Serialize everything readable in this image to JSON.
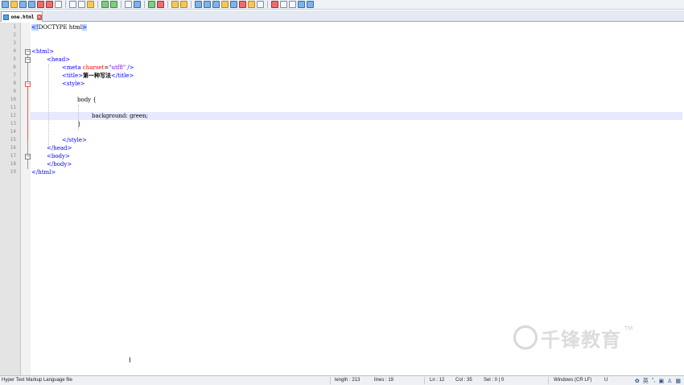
{
  "tab": {
    "label": "one.html"
  },
  "toolbar": {
    "buttons": [
      "new-file-icon",
      "open-file-icon",
      "save-icon",
      "save-all-icon",
      "close-icon",
      "close-all-icon",
      "print-icon",
      "cut-icon",
      "copy-icon",
      "paste-icon",
      "undo-icon",
      "redo-icon",
      "find-icon",
      "replace-icon",
      "zoom-in-icon",
      "zoom-out-icon",
      "sync-vertical-icon",
      "sync-horizontal-icon",
      "word-wrap-icon",
      "show-all-chars-icon",
      "indent-guide-icon",
      "udl-icon",
      "doc-map-icon",
      "function-list-icon",
      "folder-workspace-icon",
      "monitor-icon",
      "record-macro-icon",
      "stop-macro-icon",
      "play-macro-icon",
      "run-macro-icon",
      "save-macro-icon"
    ]
  },
  "editor": {
    "line_numbers": [
      "1",
      "2",
      "3",
      "4",
      "5",
      "6",
      "7",
      "8",
      "9",
      "10",
      "11",
      "12",
      "13",
      "14",
      "15",
      "16",
      "17",
      "18",
      "19"
    ],
    "lines": {
      "l1": {
        "a": "<!",
        "b": "DOCTYPE html",
        "c": ">"
      },
      "l4": "<html>",
      "l5": "<head>",
      "l6": {
        "a": "<meta",
        "b": "charset",
        "c": "=",
        "d": "\"utf8\"",
        "e": "/>"
      },
      "l7": {
        "a": "<title>",
        "b": "第一种写法",
        "c": "</title>"
      },
      "l8": "<style>",
      "l10": "body {",
      "l12": "background: green;",
      "l13": "}",
      "l15": "</style>",
      "l16": "</head>",
      "l17": "<body>",
      "l18": "</body>",
      "l19": "</html>"
    }
  },
  "watermark": {
    "text": "千锋教育",
    "tm": "TM"
  },
  "status": {
    "file_type": "Hyper Text Markup Language file",
    "length": "length : 213",
    "lines": "lines : 19",
    "ln": "Ln : 12",
    "col": "Col : 35",
    "sel": "Sel : 0 | 0",
    "eol": "Windows (CR LF)",
    "enc": "U",
    "ime": "英"
  }
}
